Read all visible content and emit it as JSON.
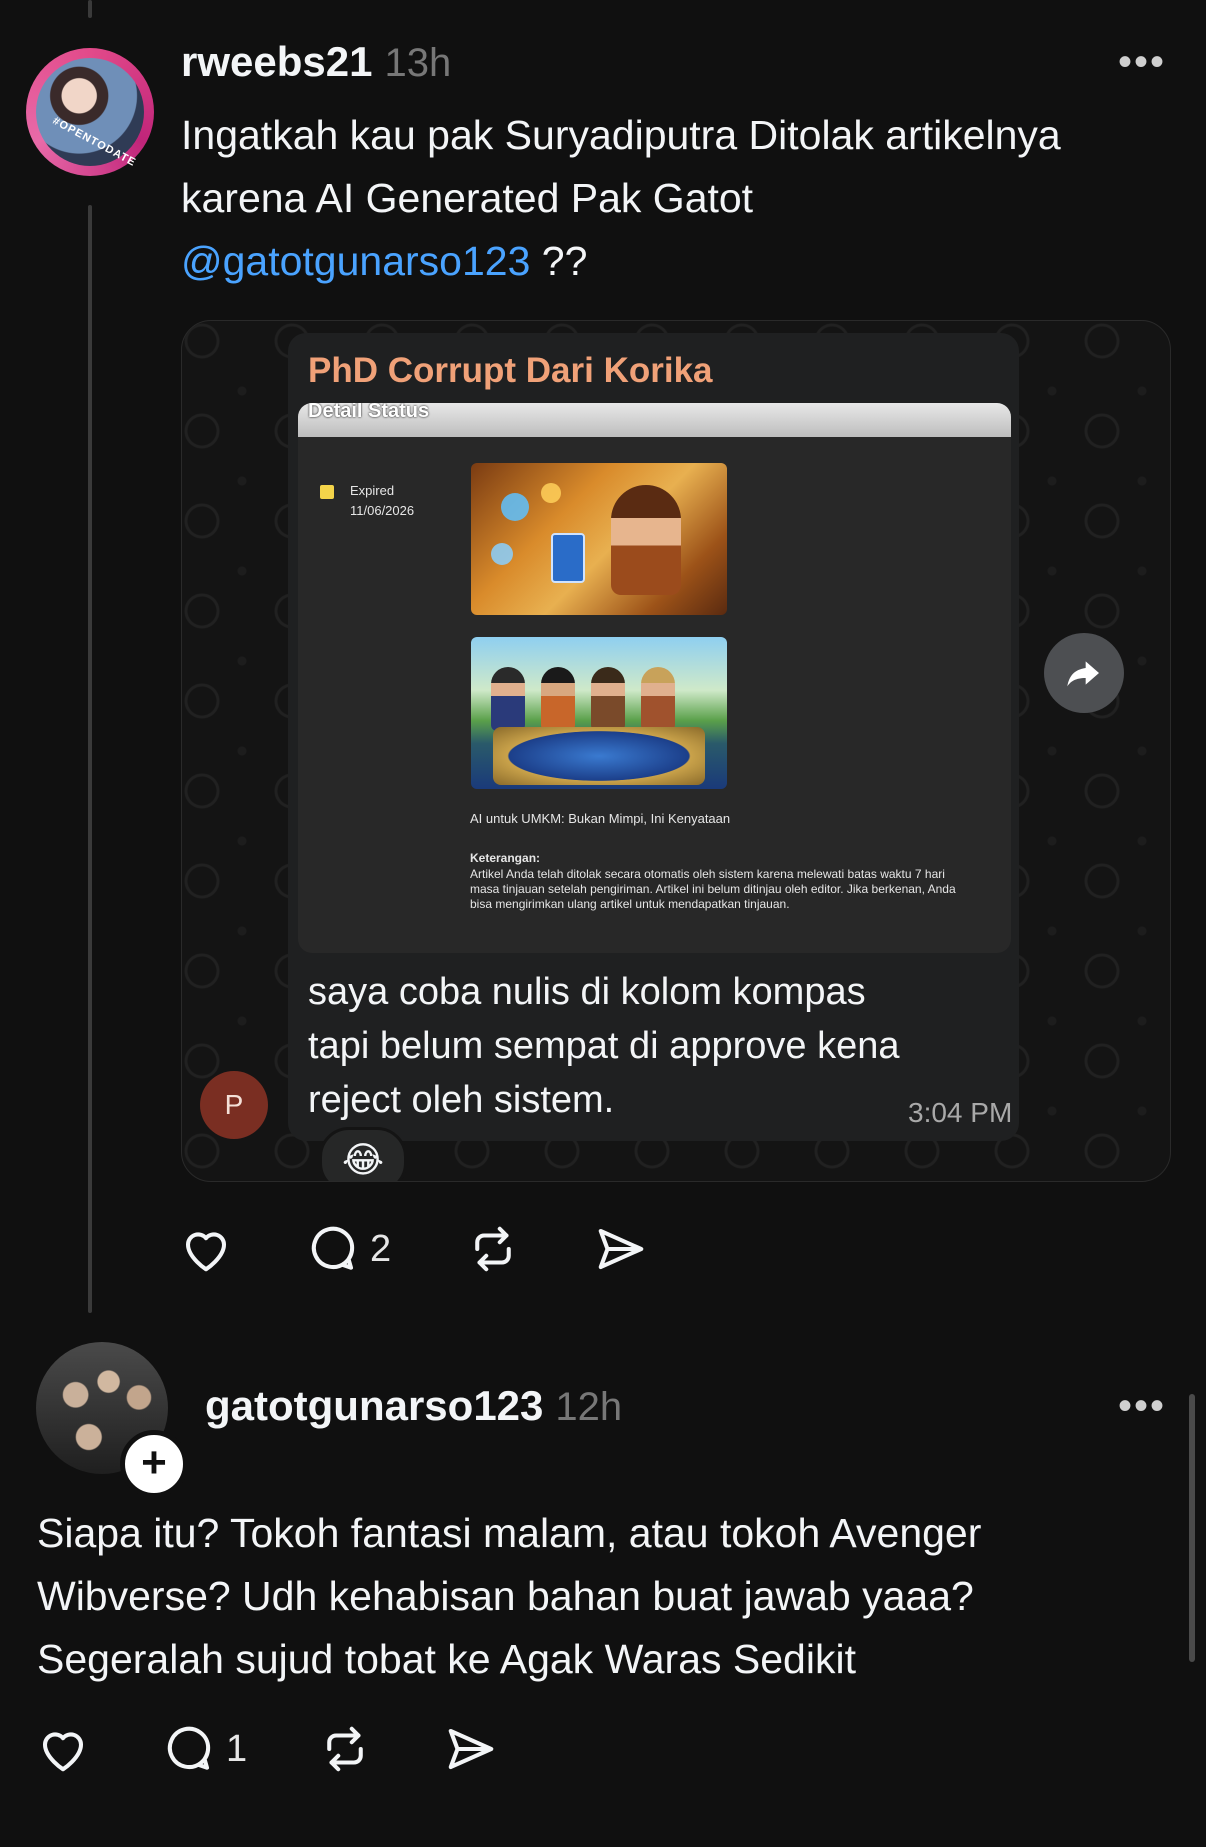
{
  "post1": {
    "username": "rweebs21",
    "time": "13h",
    "avatar_ring_text": "#OPENTODATE",
    "text_lines": [
      "Ingatkah kau pak Suryadiputra Ditolak artikelnya",
      "karena AI Generated Pak Gatot"
    ],
    "mention": "@gatotgunarso123",
    "text_after_mention": " ??",
    "media": {
      "chat_title": "PhD Corrupt Dari Korika",
      "detail_header": "Detail Status",
      "status": "Expired",
      "date": "11/06/2026",
      "caption": "AI untuk UMKM: Bukan Mimpi, Ini Kenyataan",
      "keterangan_label": "Keterangan:",
      "keterangan_text": "Artikel Anda telah ditolak secara otomatis oleh sistem karena melewati batas waktu 7 hari masa tinjauan setelah pengiriman. Artikel ini belum ditinjau oleh editor. Jika berkenan, Anda bisa mengirimkan ulang artikel untuk mendapatkan tinjauan.",
      "message_lines": [
        "saya coba nulis di kolom kompas",
        "tapi belum sempat di approve kena",
        "reject oleh sistem."
      ],
      "message_time": "3:04 PM",
      "sender_initial": "P",
      "reaction": "😂",
      "forward_icon": "forward-arrow-icon"
    },
    "reply_count": "2"
  },
  "post2": {
    "username": "gatotgunarso123",
    "time": "12h",
    "text_lines": [
      "Siapa itu? Tokoh fantasi malam, atau tokoh Avenger",
      "Wibverse? Udh kehabisan bahan buat jawab yaaa?",
      "Segeralah sujud tobat ke Agak Waras Sedikit"
    ],
    "reply_count": "1",
    "follow_icon": "plus-icon"
  },
  "more_label": "•••",
  "colors": {
    "background": "#101010",
    "mention": "#4aa3ff",
    "chat_title": "#f0a178",
    "expired_dot": "#f4d44a"
  }
}
